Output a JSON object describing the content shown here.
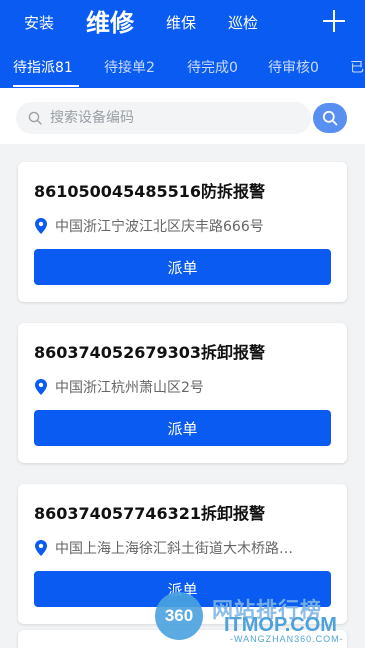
{
  "header": {
    "nav_tabs": [
      {
        "label": "安装"
      },
      {
        "label": "维修"
      },
      {
        "label": "维保"
      },
      {
        "label": "巡检"
      }
    ],
    "add_icon": "plus-icon",
    "background_color": "#0a5bf2"
  },
  "status_tabs": [
    {
      "label": "待指派81"
    },
    {
      "label": "待接单2"
    },
    {
      "label": "待完成0"
    },
    {
      "label": "待审核0"
    },
    {
      "label": "已"
    }
  ],
  "search": {
    "placeholder": "搜索设备编码",
    "value": "",
    "icon": "search-icon",
    "button_icon": "search-icon"
  },
  "orders": [
    {
      "title": "861050045485516防拆报警",
      "address": "中国浙江宁波江北区庆丰路666号",
      "action_label": "派单"
    },
    {
      "title": "860374052679303拆卸报警",
      "address": "中国浙江杭州萧山区2号",
      "action_label": "派单"
    },
    {
      "title": "860374057746321拆卸报警",
      "address": "中国上海上海徐汇斜土街道大木桥路…",
      "action_label": "派单"
    }
  ],
  "watermark": {
    "logo_text": "360",
    "title": "网站排行榜",
    "domain": "ITMOP.COM",
    "subdomain": "-WANGZHAN360.COM-"
  },
  "colors": {
    "accent": "#0a5bf2",
    "background": "#f2f3f5",
    "location_pin": "#0a5bf2"
  }
}
